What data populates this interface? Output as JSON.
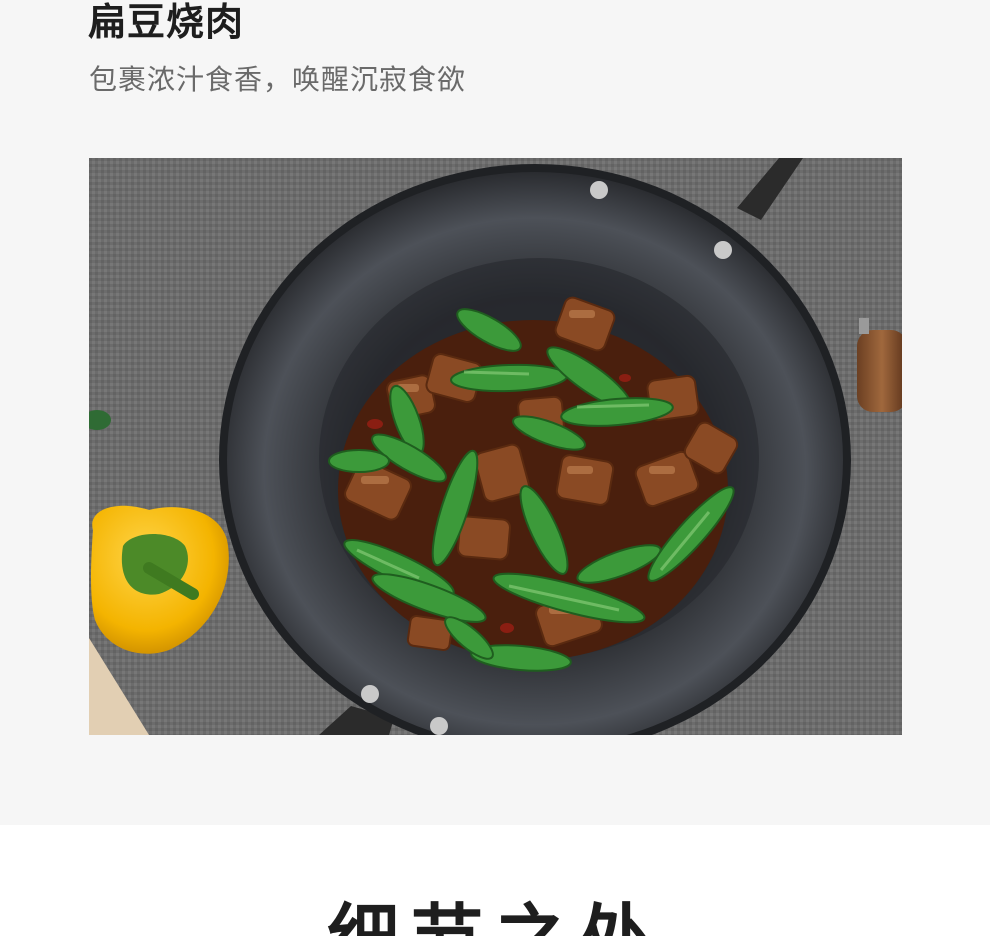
{
  "dish": {
    "title": "扁豆烧肉",
    "subtitle": "包裹浓汁食香，唤醒沉寂食欲"
  },
  "photo": {
    "subject": "wok-with-braised-pork-and-snow-peas"
  },
  "next_section": {
    "heading": "细节之处"
  },
  "colors": {
    "band_background": "#f6f6f6",
    "title_text": "#1e1e1e",
    "subtitle_text": "#6a6a6a"
  }
}
